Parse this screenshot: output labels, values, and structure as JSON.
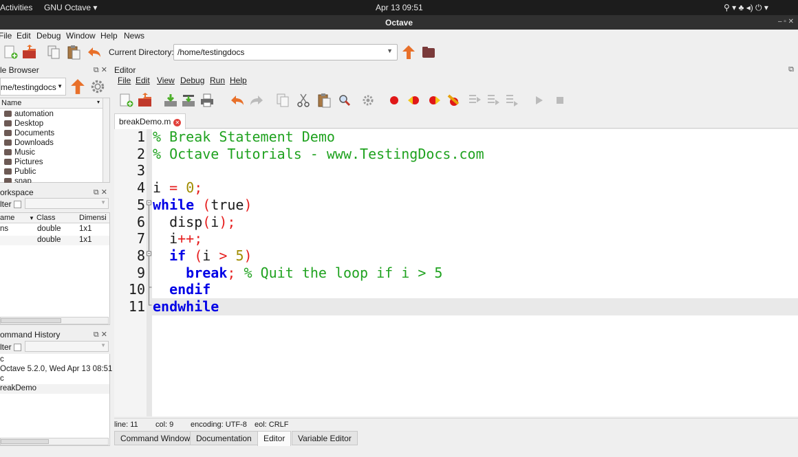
{
  "topbar": {
    "activities": "Activities",
    "app_menu": "GNU Octave ▾",
    "clock": "Apr 13  09:51",
    "tray": "⚲ ▾   ♣ ◂) ⏻ ▾"
  },
  "window": {
    "title": "Octave",
    "controls": "–  ▫  ✕"
  },
  "menubar": [
    "File",
    "Edit",
    "Debug",
    "Window",
    "Help",
    "News"
  ],
  "toolbar": {
    "current_dir_label": "Current Directory:",
    "current_dir_value": "/home/testingdocs"
  },
  "file_browser": {
    "title": "le Browser",
    "path": "me/testingdocs",
    "column": "Name",
    "items": [
      "automation",
      "Desktop",
      "Documents",
      "Downloads",
      "Music",
      "Pictures",
      "Public",
      "snap"
    ]
  },
  "workspace": {
    "title": "orkspace",
    "filter_label": "lter",
    "columns": [
      "ame",
      "Class",
      "Dimensi"
    ],
    "rows": [
      {
        "name": "ns",
        "class": "double",
        "dim": "1x1"
      },
      {
        "name": "",
        "class": "double",
        "dim": "1x1"
      }
    ]
  },
  "command_history": {
    "title": "ommand History",
    "filter_label": "lter",
    "lines": [
      "c",
      "Octave 5.2.0, Wed Apr 13 08:51",
      "c",
      "reakDemo"
    ]
  },
  "editor": {
    "title": "Editor",
    "menu": [
      "File",
      "Edit",
      "View",
      "Debug",
      "Run",
      "Help"
    ],
    "tab": "breakDemo.m",
    "line_numbers": [
      "1",
      "2",
      "3",
      "4",
      "5",
      "6",
      "7",
      "8",
      "9",
      "10",
      "11"
    ],
    "status": {
      "line": "line: 11",
      "col": "col: 9",
      "encoding": "encoding: UTF-8",
      "eol": "eol: CRLF"
    }
  },
  "bottom_tabs": [
    "Command Window",
    "Documentation",
    "Editor",
    "Variable Editor"
  ],
  "colors": {
    "comment": "#1fa21f",
    "keyword": "#0000e6",
    "operator": "#e61e1e",
    "number": "#a08c00"
  }
}
